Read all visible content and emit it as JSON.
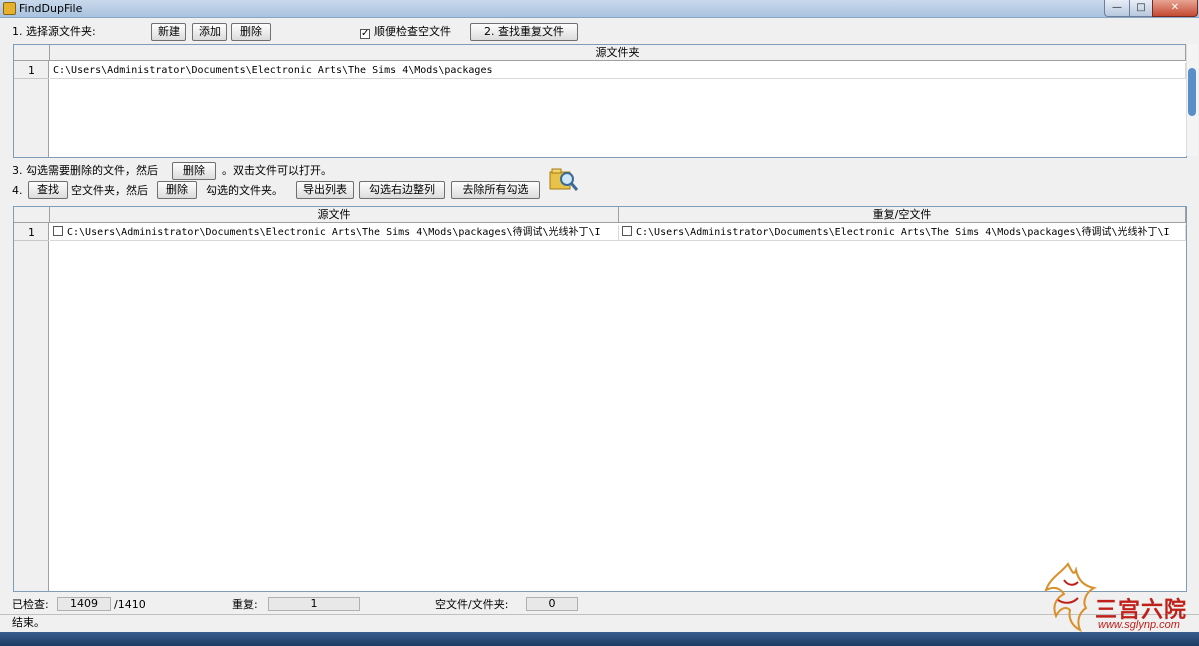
{
  "window": {
    "title": "FindDupFile",
    "min_glyph": "—",
    "max_glyph": "□",
    "close_glyph": "✕"
  },
  "step1": {
    "label": "1. 选择源文件夹:",
    "new_label": "新建",
    "add_label": "添加",
    "delete_label": "删除",
    "check_empty_checked": true,
    "check_empty_label": "顺便检查空文件",
    "find_dup_label": "2. 查找重复文件"
  },
  "source_grid": {
    "column_header": "源文件夹",
    "rows": [
      {
        "num": "1",
        "path": "C:\\Users\\Administrator\\Documents\\Electronic Arts\\The Sims 4\\Mods\\packages"
      }
    ]
  },
  "step3": {
    "prefix": "3. 勾选需要删除的文件，然后",
    "delete_label": "删除",
    "suffix": "。双击文件可以打开。"
  },
  "step4": {
    "prefix": "4.",
    "find_label": "查找",
    "mid": "空文件夹，然后",
    "delete_label": "删除",
    "after": "勾选的文件夹。",
    "export_label": "导出列表",
    "select_right_label": "勾选右边整列",
    "clear_all_label": "去除所有勾选"
  },
  "result_grid": {
    "col_source": "源文件",
    "col_dup": "重复/空文件",
    "rows": [
      {
        "num": "1",
        "source": "C:\\Users\\Administrator\\Documents\\Electronic Arts\\The Sims 4\\Mods\\packages\\待调试\\光线补丁\\I",
        "dup": "C:\\Users\\Administrator\\Documents\\Electronic Arts\\The Sims 4\\Mods\\packages\\待调试\\光线补丁\\I"
      }
    ]
  },
  "stats": {
    "checked_label": "已检查:",
    "checked_value": "1409",
    "checked_total": "/1410",
    "dup_label": "重复:",
    "dup_value": "1",
    "empty_label": "空文件/文件夹:",
    "empty_value": "0"
  },
  "status": {
    "text": "结束。"
  },
  "watermark": {
    "text": "三宫六院",
    "url": "www.sglynp.com"
  },
  "colors": {
    "accent": "#5a8fc9",
    "watermark": "#c0201a"
  }
}
